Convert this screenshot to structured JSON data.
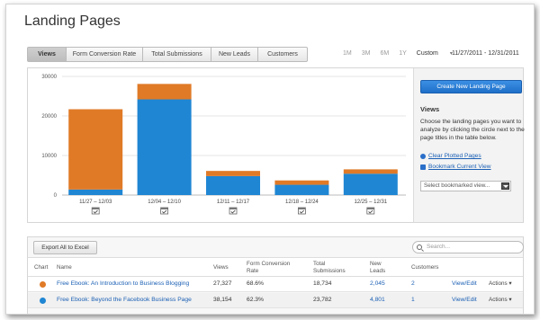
{
  "page": {
    "title": "Landing Pages"
  },
  "metric_tabs": [
    "Views",
    "Form Conversion Rate",
    "Total Submissions",
    "New Leads",
    "Customers"
  ],
  "ranges": [
    "1M",
    "3M",
    "6M",
    "1Y"
  ],
  "custom_label": "Custom",
  "custom_arrow": "▾",
  "date_range": "11/27/2011 - 12/31/2011",
  "colors": {
    "blue": "#1f86d3",
    "orange": "#e07a27",
    "link": "#1a5fb4"
  },
  "chart_data": {
    "type": "bar",
    "categories": [
      "11/27 – 12/03",
      "12/04 – 12/10",
      "12/11 – 12/17",
      "12/18 – 12/24",
      "12/25 – 12/31"
    ],
    "series": [
      {
        "values": [
          1400,
          24200,
          4800,
          2600,
          5400
        ]
      },
      {
        "values": [
          20300,
          3900,
          1300,
          1100,
          1100
        ]
      }
    ],
    "stacked": true,
    "ylim": [
      0,
      30000
    ],
    "yticks": [
      "0",
      "10000",
      "20000",
      "30000"
    ],
    "grid": true
  },
  "side_panel": {
    "create_button": "Create New Landing Page",
    "title": "Views",
    "description": "Choose the landing pages you want to analyze by clicking the circle next to the page titles in the table below.",
    "clear_link": "Clear Plotted Pages",
    "bookmark_link": "Bookmark Current View",
    "bookmark_select": "Select bookmarked view..."
  },
  "table": {
    "export_button": "Export All to Excel",
    "search_placeholder": "Search...",
    "headers": {
      "chart": "Chart",
      "name": "Name",
      "views": "Views",
      "fcr": "Form Conversion Rate",
      "submissions": "Total Submissions",
      "leads": "New Leads",
      "customers": "Customers"
    },
    "rows": [
      {
        "name": "Free Ebook: An Introduction to Business Blogging",
        "views": "27,327",
        "fcr": "68.6%",
        "submissions": "18,734",
        "leads": "2,045",
        "customers": "2",
        "view_edit": "View/Edit",
        "actions": "Actions ▾",
        "dot_color": "#e07a27"
      },
      {
        "name": "Free Ebook: Beyond the Facebook Business Page",
        "views": "38,154",
        "fcr": "62.3%",
        "submissions": "23,782",
        "leads": "4,801",
        "customers": "1",
        "view_edit": "View/Edit",
        "actions": "Actions ▾",
        "dot_color": "#1f86d3"
      }
    ]
  }
}
